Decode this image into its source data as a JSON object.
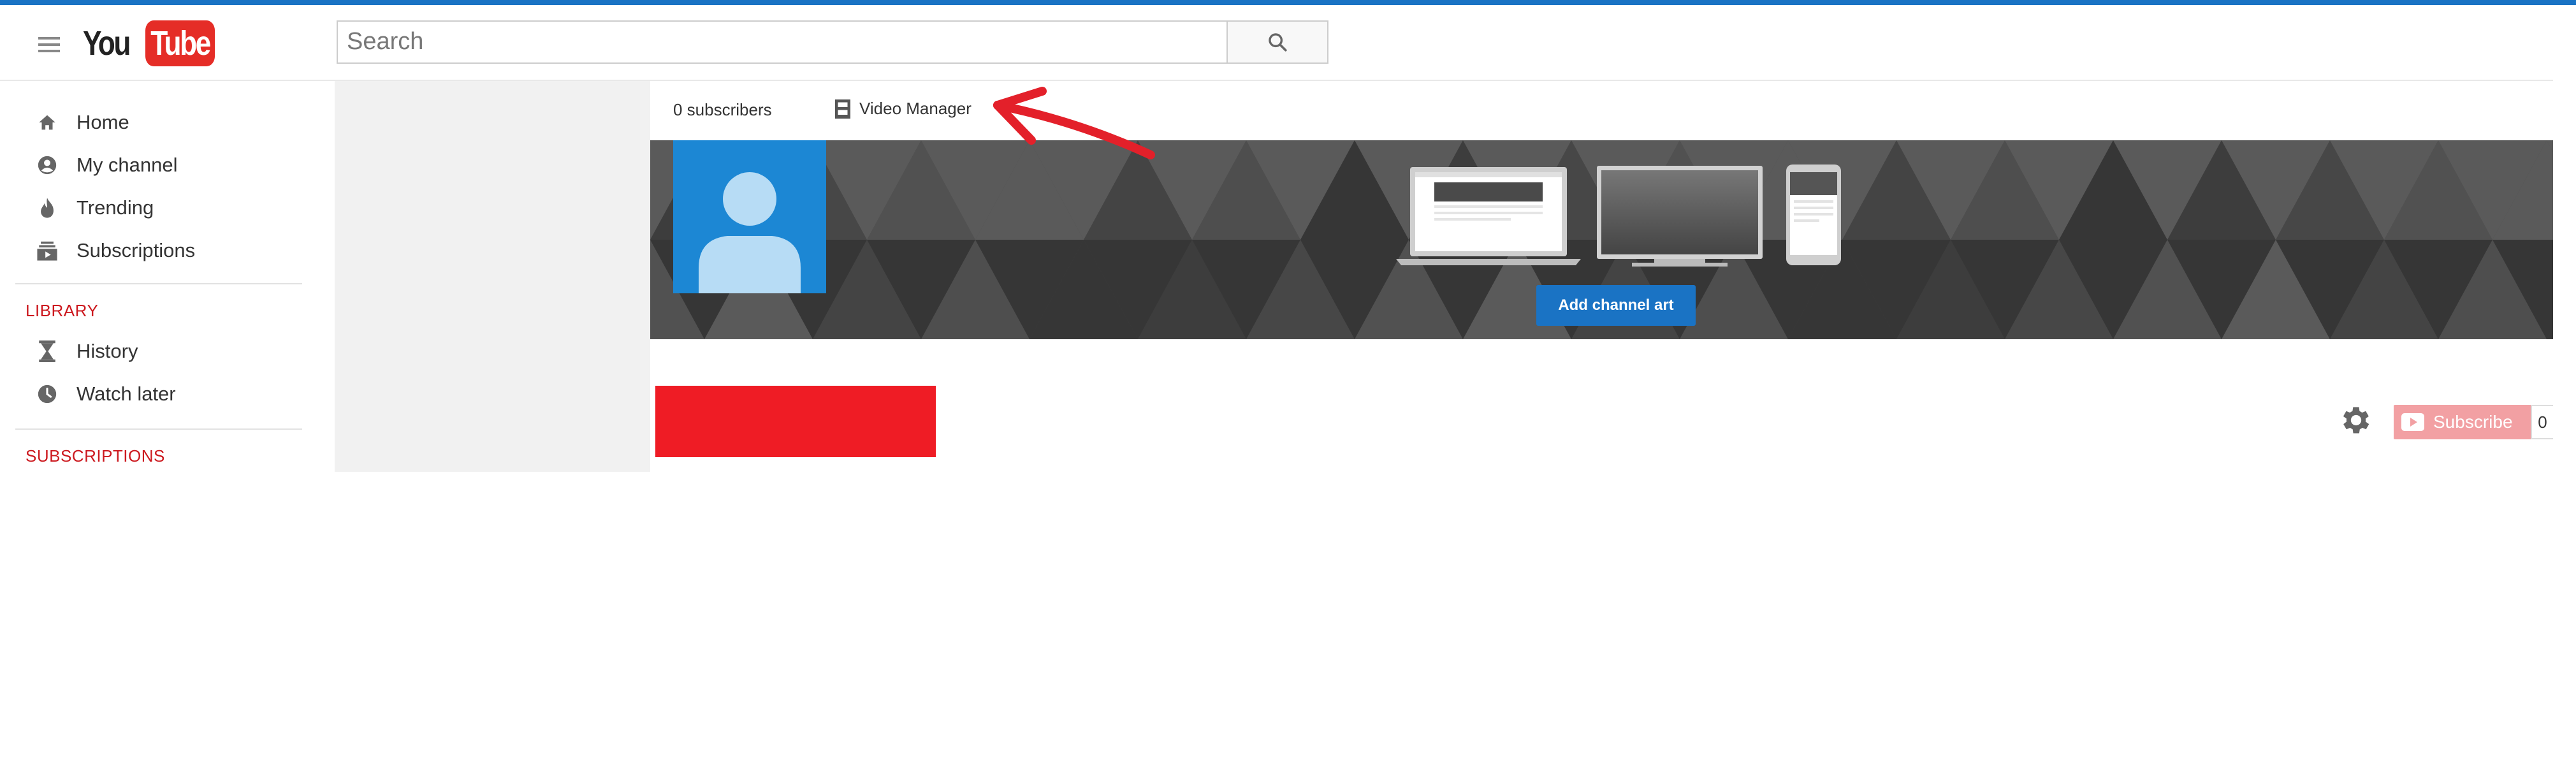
{
  "search": {
    "placeholder": "Search"
  },
  "logo": {
    "you": "You",
    "tube": "Tube"
  },
  "sidebar": {
    "items": [
      {
        "label": "Home",
        "icon": "home-icon"
      },
      {
        "label": "My channel",
        "icon": "account-icon"
      },
      {
        "label": "Trending",
        "icon": "flame-icon"
      },
      {
        "label": "Subscriptions",
        "icon": "subscriptions-icon"
      }
    ],
    "library_label": "LIBRARY",
    "library_items": [
      {
        "label": "History",
        "icon": "hourglass-icon"
      },
      {
        "label": "Watch later",
        "icon": "clock-icon"
      }
    ],
    "subscriptions_label": "SUBSCRIPTIONS"
  },
  "channel": {
    "subscribers": "0 subscribers",
    "video_manager": "Video Manager",
    "add_channel_art": "Add channel art",
    "subscribe_label": "Subscribe",
    "subscribe_count": "0"
  },
  "colors": {
    "accent": "#1a73c4",
    "brand_red": "#e52d27",
    "section_red": "#cc181e",
    "avatar_blue": "#1c87d4",
    "annotation_arrow": "#e3202a"
  }
}
